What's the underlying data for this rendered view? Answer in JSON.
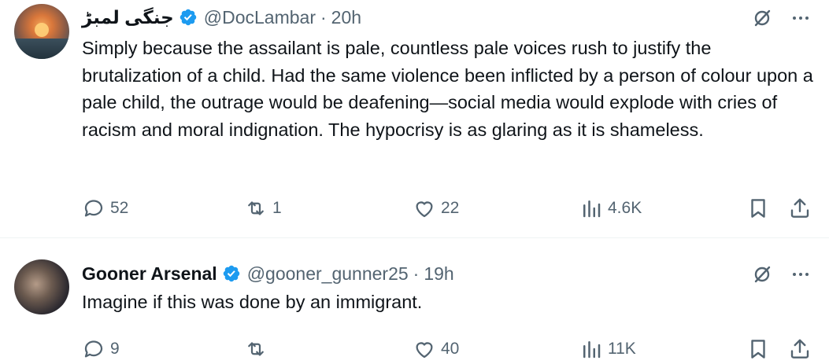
{
  "tweets": [
    {
      "name": "جنگی لمبڑ",
      "handle": "@DocLambar",
      "separator": "·",
      "time": "20h",
      "text": "Simply because the assailant is pale, countless pale voices rush to justify the brutalization of a child. Had the same violence been inflicted by a person of colour upon a pale child, the outrage would be deafening—social media would explode with cries of racism and moral indignation. The hypocrisy is as glaring as it is shameless.",
      "replies": "52",
      "reposts": "1",
      "likes": "22",
      "views": "4.6K"
    },
    {
      "name": "Gooner Arsenal",
      "handle": "@gooner_gunner25",
      "separator": "·",
      "time": "19h",
      "text": "Imagine if this was done by an immigrant.",
      "replies": "9",
      "reposts": "",
      "likes": "40",
      "views": "11K"
    }
  ],
  "colors": {
    "text": "#0f1419",
    "muted": "#536471",
    "verified": "#1d9bf0",
    "divider": "#eff3f4"
  }
}
